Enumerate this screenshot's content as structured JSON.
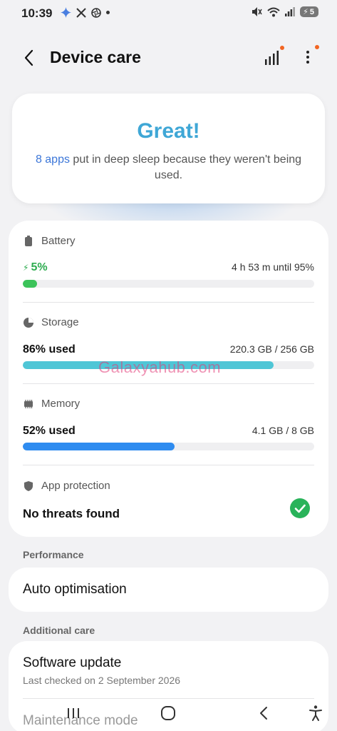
{
  "status_bar": {
    "time": "10:39",
    "battery_level": "5"
  },
  "header": {
    "title": "Device care"
  },
  "hero": {
    "title": "Great!",
    "apps_link": "8 apps",
    "message": " put in deep sleep because they weren't being used."
  },
  "battery": {
    "label": "Battery",
    "value": "5%",
    "detail": "4 h 53 m until 95%",
    "fraction": 0.05,
    "color": "#3cc35a"
  },
  "storage": {
    "label": "Storage",
    "value": "86% used",
    "detail": "220.3 GB / 256 GB",
    "fraction": 0.86,
    "color": "#4fc6d6"
  },
  "memory": {
    "label": "Memory",
    "value": "52% used",
    "detail": "4.1 GB / 8 GB",
    "fraction": 0.52,
    "color": "#2f8cf0"
  },
  "app_protection": {
    "label": "App protection",
    "value": "No threats found"
  },
  "performance": {
    "label": "Performance",
    "auto_optimisation": "Auto optimisation"
  },
  "additional_care": {
    "label": "Additional care",
    "software_update": "Software update",
    "software_update_sub": "Last checked on 2 September 2026",
    "maintenance_mode": "Maintenance mode"
  },
  "watermark": "Galaxyahub.com",
  "icons": {
    "back": "arrow-left-icon",
    "signal": "signal-bars-icon",
    "more": "more-vertical-icon",
    "battery": "battery-icon",
    "storage": "pie-chart-icon",
    "memory": "chip-icon",
    "protection": "shield-icon",
    "check": "check-circle-icon"
  }
}
